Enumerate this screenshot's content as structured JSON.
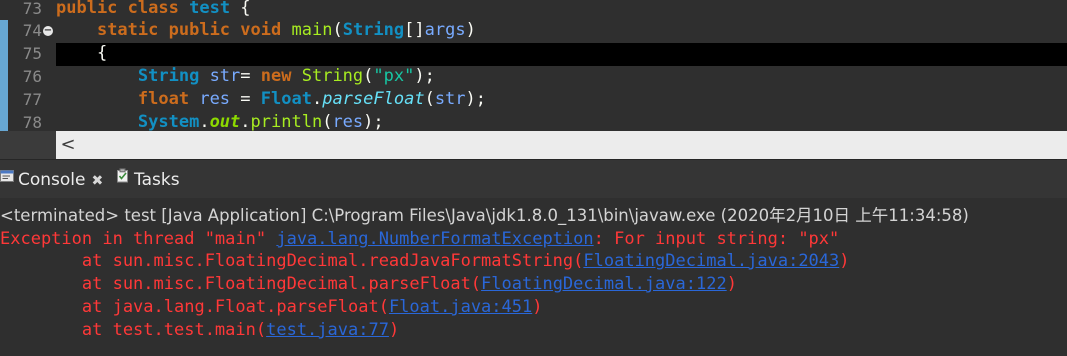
{
  "editor": {
    "lines": [
      {
        "num": "73",
        "tokens": [
          {
            "t": "public",
            "c": "kw"
          },
          {
            "t": " ",
            "c": "plain"
          },
          {
            "t": "class",
            "c": "kw"
          },
          {
            "t": " ",
            "c": "plain"
          },
          {
            "t": "test",
            "c": "cls"
          },
          {
            "t": " {",
            "c": "pn"
          }
        ]
      },
      {
        "num": "74",
        "fold": true,
        "tokens": [
          {
            "t": "    ",
            "c": "plain"
          },
          {
            "t": "static",
            "c": "kw"
          },
          {
            "t": " ",
            "c": "plain"
          },
          {
            "t": "public",
            "c": "kw"
          },
          {
            "t": " ",
            "c": "plain"
          },
          {
            "t": "void",
            "c": "kw"
          },
          {
            "t": " ",
            "c": "plain"
          },
          {
            "t": "main",
            "c": "mth"
          },
          {
            "t": "(",
            "c": "pn"
          },
          {
            "t": "String",
            "c": "cls"
          },
          {
            "t": "[]",
            "c": "pn"
          },
          {
            "t": "args",
            "c": "var"
          },
          {
            "t": ")",
            "c": "pn"
          }
        ]
      },
      {
        "num": "75",
        "current": true,
        "tokens": [
          {
            "t": "    ",
            "c": "plain"
          },
          {
            "t": "{",
            "c": "pn"
          }
        ]
      },
      {
        "num": "76",
        "tokens": [
          {
            "t": "        ",
            "c": "plain"
          },
          {
            "t": "String",
            "c": "cls"
          },
          {
            "t": " ",
            "c": "plain"
          },
          {
            "t": "str",
            "c": "var"
          },
          {
            "t": "= ",
            "c": "pn"
          },
          {
            "t": "new",
            "c": "kw"
          },
          {
            "t": " ",
            "c": "plain"
          },
          {
            "t": "String",
            "c": "mth"
          },
          {
            "t": "(",
            "c": "pn"
          },
          {
            "t": "\"px\"",
            "c": "str"
          },
          {
            "t": ");",
            "c": "pn"
          }
        ]
      },
      {
        "num": "77",
        "tokens": [
          {
            "t": "        ",
            "c": "plain"
          },
          {
            "t": "float",
            "c": "kw"
          },
          {
            "t": " ",
            "c": "plain"
          },
          {
            "t": "res",
            "c": "var"
          },
          {
            "t": " = ",
            "c": "pn"
          },
          {
            "t": "Float",
            "c": "cls"
          },
          {
            "t": ".",
            "c": "pn"
          },
          {
            "t": "parseFloat",
            "c": "smt"
          },
          {
            "t": "(",
            "c": "pn"
          },
          {
            "t": "str",
            "c": "var"
          },
          {
            "t": ");",
            "c": "pn"
          }
        ]
      },
      {
        "num": "78",
        "tokens": [
          {
            "t": "        ",
            "c": "plain"
          },
          {
            "t": "System",
            "c": "cls"
          },
          {
            "t": ".",
            "c": "pn"
          },
          {
            "t": "out",
            "c": "fld"
          },
          {
            "t": ".",
            "c": "pn"
          },
          {
            "t": "println",
            "c": "mth"
          },
          {
            "t": "(",
            "c": "pn"
          },
          {
            "t": "res",
            "c": "var"
          },
          {
            "t": ");",
            "c": "pn"
          }
        ]
      }
    ]
  },
  "scrollbar": {
    "left_arrow": "<"
  },
  "tabs": {
    "console_label": "Console",
    "console_close": "✖",
    "tasks_label": "Tasks"
  },
  "console": {
    "status": "<terminated> test [Java Application] C:\\Program Files\\Java\\jdk1.8.0_131\\bin\\javaw.exe (2020年2月10日 上午11:34:58)",
    "output": [
      [
        {
          "t": "Exception in thread \"main\" "
        },
        {
          "t": "java.lang.NumberFormatException",
          "link": true
        },
        {
          "t": ": For input string: \"px\""
        }
      ],
      [
        {
          "t": "\tat sun.misc.FloatingDecimal.readJavaFormatString("
        },
        {
          "t": "FloatingDecimal.java:2043",
          "link": true
        },
        {
          "t": ")"
        }
      ],
      [
        {
          "t": "\tat sun.misc.FloatingDecimal.parseFloat("
        },
        {
          "t": "FloatingDecimal.java:122",
          "link": true
        },
        {
          "t": ")"
        }
      ],
      [
        {
          "t": "\tat java.lang.Float.parseFloat("
        },
        {
          "t": "Float.java:451",
          "link": true
        },
        {
          "t": ")"
        }
      ],
      [
        {
          "t": "\tat test.test.main("
        },
        {
          "t": "test.java:77",
          "link": true
        },
        {
          "t": ")"
        }
      ]
    ]
  },
  "colors": {
    "editor_bg": "#2f2f2f",
    "keyword": "#cc6c1d",
    "class": "#1290c3",
    "error_text": "#ff3838",
    "link": "#2a67d8"
  }
}
